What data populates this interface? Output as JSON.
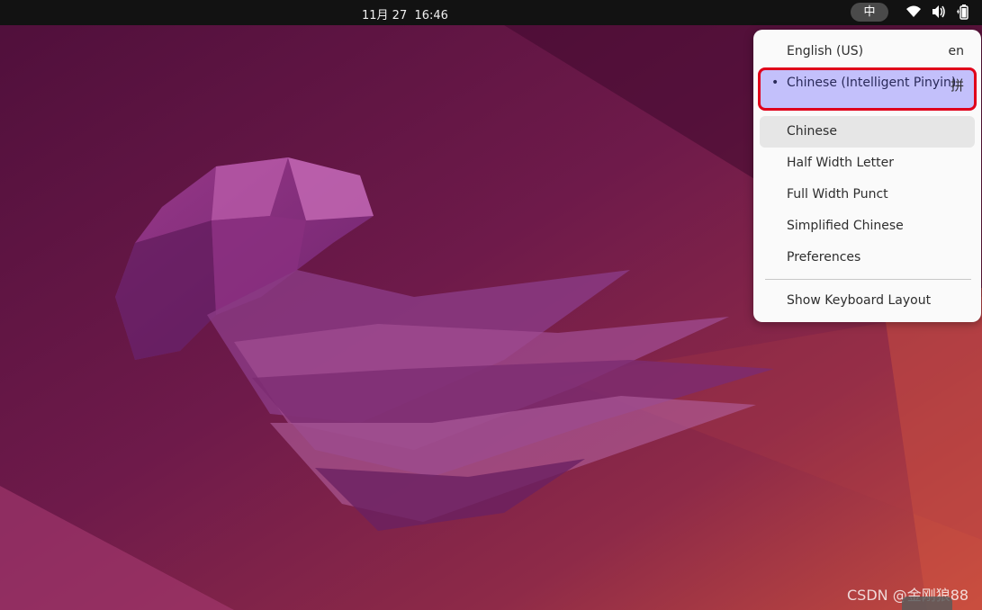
{
  "topbar": {
    "clock": "11月 27  16:46",
    "ime_indicator": "中",
    "icons": [
      "wifi-icon",
      "volume-icon",
      "battery-icon"
    ]
  },
  "ime_menu": {
    "items": [
      {
        "label": "English (US)",
        "accel": "en"
      },
      {
        "label": "Chinese (Intelligent Pinyin)",
        "accel": "拼",
        "bullet": "•",
        "active": true,
        "highlight_color": "#c3c0fb",
        "annotation_border_color": "#e0001a"
      },
      {
        "label": "Chinese",
        "hovered": true
      },
      {
        "label": "Half Width Letter"
      },
      {
        "label": "Full Width Punct"
      },
      {
        "label": "Simplified Chinese"
      },
      {
        "label": "Preferences"
      },
      {
        "label": "Show Keyboard Layout"
      }
    ]
  },
  "watermark": "CSDN @金刚狼88",
  "colors": {
    "topbar": "#121212",
    "menu_bg": "#fafafa",
    "wallpaper_primary": "#6b1b4e",
    "wallpaper_accent": "#c0423d"
  }
}
